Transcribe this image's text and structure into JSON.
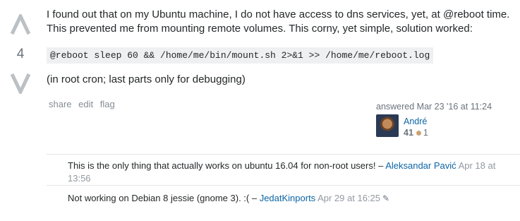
{
  "vote": {
    "score": "4"
  },
  "answer": {
    "paragraph1": "I found out that on my Ubuntu machine, I do not have access to dns services, yet, at @reboot time. This prevented me from mounting remote volumes. This corny, yet simple, solution worked:",
    "code": "@reboot sleep 60 && /home/me/bin/mount.sh 2>&1 >> /home/me/reboot.log",
    "paragraph2": "(in root cron; last parts only for debugging)"
  },
  "post_menu": {
    "share": "share",
    "edit": "edit",
    "flag": "flag"
  },
  "signature": {
    "action": "answered Mar 23 '16 at 11:24",
    "user_name": "André",
    "reputation": "41",
    "bronze_badges": "1"
  },
  "comments": [
    {
      "text": "This is the only thing that actually works on ubuntu 16.04 for non-root users! – ",
      "user": "Aleksandar Pavić",
      "date": "Apr 18 at 13:56"
    },
    {
      "text": "Not working on Debian 8 jessie (gnome 3). :( – ",
      "user": "JedatKinports",
      "date": "Apr 29 at 16:25"
    }
  ],
  "colors": {
    "link": "#0c65a5",
    "muted": "#6a737c",
    "code_bg": "#eff0f1",
    "bronze": "#cda373"
  }
}
